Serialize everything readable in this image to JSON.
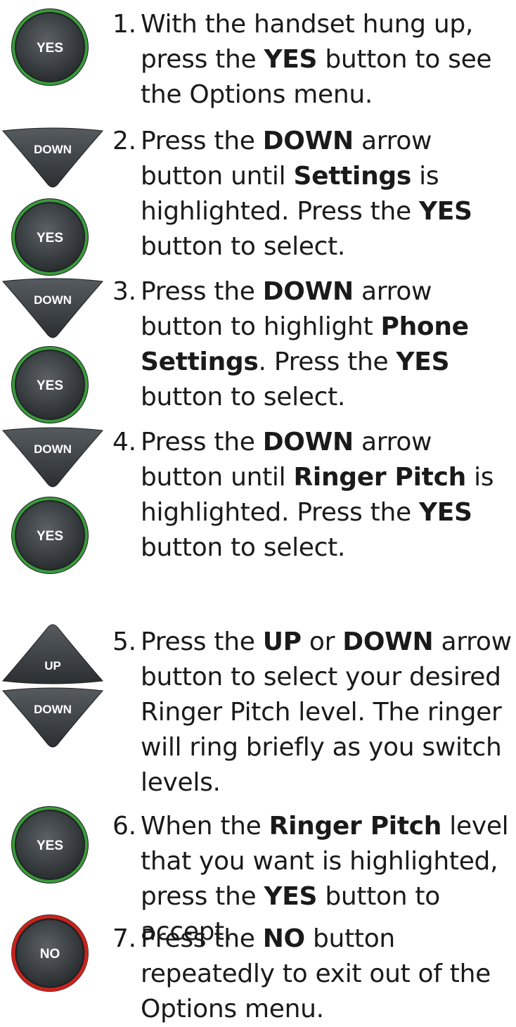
{
  "buttons": {
    "yes_label": "YES",
    "no_label": "NO",
    "down_label": "DOWN",
    "up_label": "UP"
  },
  "colors": {
    "yes_ring": "#3a9a3a",
    "no_ring": "#c8241c",
    "button_body": "#3a3f42",
    "text": "#1a1a1a"
  },
  "steps": [
    {
      "num": "1.",
      "parts": [
        "With the handset hung up, press the ",
        "YES",
        " button to see the Options menu."
      ]
    },
    {
      "num": "2.",
      "parts": [
        "Press the ",
        "DOWN",
        " arrow button until ",
        "Settings",
        " is highlighted. Press the ",
        "YES",
        " button to select."
      ]
    },
    {
      "num": "3.",
      "parts": [
        "Press the ",
        "DOWN",
        " arrow button to highlight ",
        "Phone Settings",
        ". Press the ",
        "YES",
        " button to select."
      ]
    },
    {
      "num": "4.",
      "parts": [
        "Press the ",
        "DOWN",
        " arrow button until ",
        "Ringer Pitch",
        " is highlighted. Press the ",
        "YES",
        " button to select."
      ]
    },
    {
      "num": "5.",
      "parts": [
        "Press the ",
        "UP",
        " or ",
        "DOWN",
        " arrow button to select your desired Ringer Pitch level. The ringer will ring briefly as you switch levels."
      ]
    },
    {
      "num": "6.",
      "parts": [
        "When the ",
        "Ringer Pitch",
        " level that you want is highlighted, press the ",
        "YES",
        " button to accept."
      ]
    },
    {
      "num": "7.",
      "parts": [
        "Press the ",
        "NO",
        " button repeatedly to exit out of the Options menu."
      ]
    }
  ]
}
